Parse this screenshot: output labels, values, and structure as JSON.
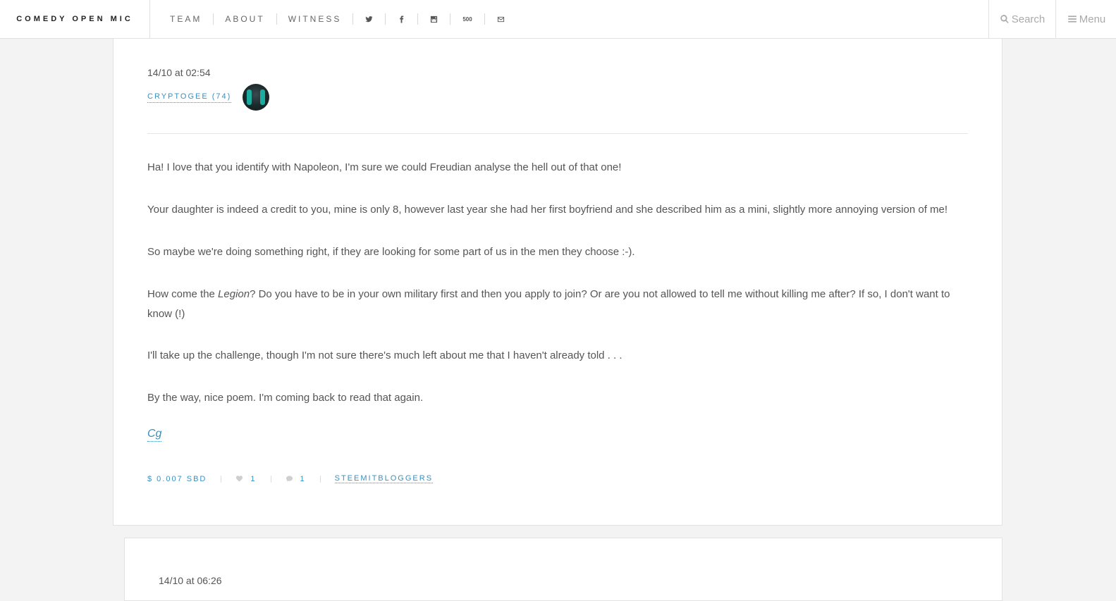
{
  "header": {
    "brand": "COMEDY OPEN MIC",
    "nav": [
      "TEAM",
      "ABOUT",
      "WITNESS"
    ],
    "social_icons": [
      "twitter-icon",
      "facebook-icon",
      "instagram-icon",
      "500px-icon",
      "envelope-icon"
    ],
    "fivehundred_label": "500",
    "search_label": "Search",
    "menu_label": "Menu"
  },
  "comment": {
    "date": "14/10 at 02:54",
    "author": "CRYPTOGEE (74)",
    "paragraphs": {
      "p1": "Ha! I love that you identify with Napoleon, I'm sure we could Freudian analyse the hell out of that one!",
      "p2": "Your daughter is indeed a credit to you, mine is only 8, however last year she had her first boyfriend and she described him as a mini, slightly more annoying version of me!",
      "p3": "So maybe we're doing something right, if they are looking for some part of us in the men they choose :-).",
      "p4_before": "How come the ",
      "p4_italic": "Legion",
      "p4_after": "? Do you have to be in your own military first and then you apply to join? Or are you not allowed to tell me without killing me after? If so, I don't want to know (!)",
      "p5": "I'll take up the challenge, though I'm not sure there's much left about me that I haven't already told . . .",
      "p6": "By the way, nice poem. I'm coming back to read that again."
    },
    "signature": "Cg",
    "meta": {
      "payout": "$ 0.007 SBD",
      "likes": "1",
      "replies": "1",
      "tag": "STEEMITBLOGGERS"
    }
  },
  "next_comment": {
    "date": "14/10 at 06:26"
  }
}
